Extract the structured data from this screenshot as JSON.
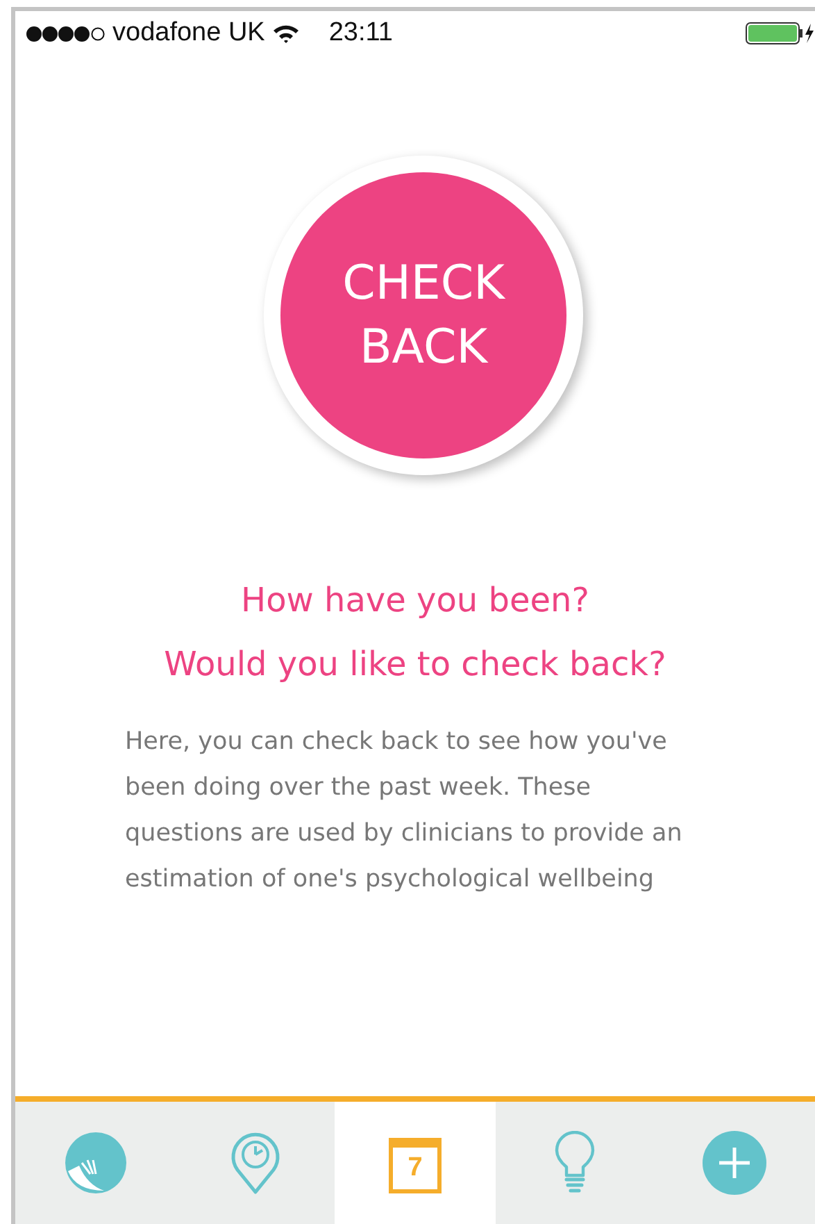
{
  "status_bar": {
    "carrier": "vodafone UK",
    "time": "23:11"
  },
  "badge": {
    "lines": [
      "CHECK",
      "BACK"
    ]
  },
  "headline": [
    "How have you been?",
    "Would you like to check back?"
  ],
  "body": "Here, you can check back to see how you've been doing over the past week. These questions are used by clinicians to provide an estimation of one's psychological wellbeing",
  "tabs": [
    {
      "kind": "leaf",
      "selected": false
    },
    {
      "kind": "pin",
      "selected": false
    },
    {
      "kind": "calendar",
      "label": "7",
      "selected": true
    },
    {
      "kind": "bulb",
      "selected": false
    },
    {
      "kind": "plus",
      "selected": false
    }
  ]
}
